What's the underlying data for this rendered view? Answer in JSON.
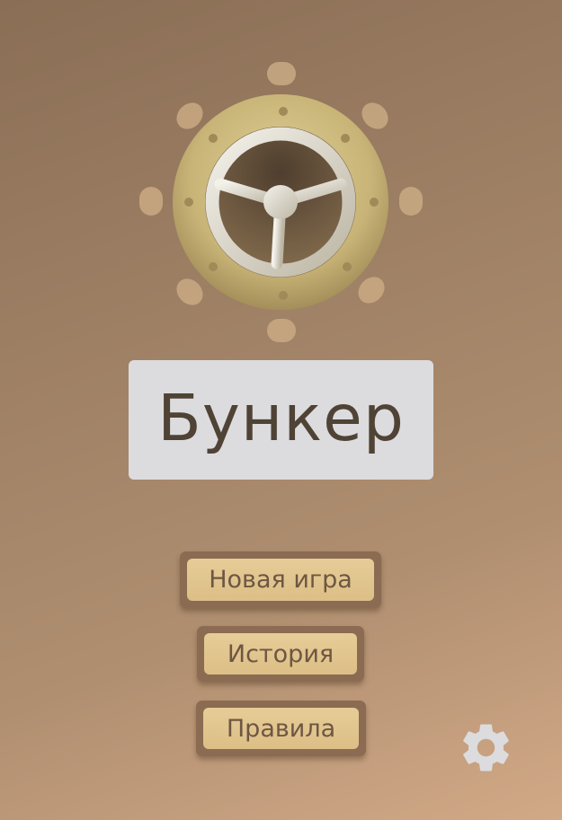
{
  "title": "Бункер",
  "menu": {
    "new_game": "Новая игра",
    "history": "История",
    "rules": "Правила"
  },
  "icons": {
    "emblem": "bunker-hatch-wheel-icon",
    "settings": "gear-icon"
  },
  "colors": {
    "background_top": "#8a6e55",
    "background_bottom": "#d2a987",
    "title_box": "#dcdcde",
    "title_text": "#4f4336",
    "button_frame": "#8b6b52",
    "button_face": "#e2c78f",
    "button_text": "#6e5643",
    "hatch_rim": "#c9b57c",
    "wheel": "#e0dbcf",
    "settings_icon": "#dcdcde"
  }
}
